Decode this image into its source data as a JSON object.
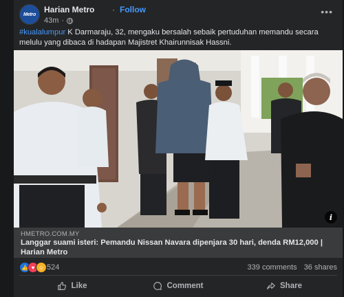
{
  "post": {
    "page_name": "Harian Metro",
    "follow_label": "Follow",
    "avatar_text": "Metro",
    "time": "43m",
    "caption_hashtag": "#kualalumpur",
    "caption_text": " K Darmaraju, 32, mengaku bersalah sebaik pertuduhan memandu secara melulu yang dibaca di hadapan Majistret Khairunnisak Hassni.",
    "more_icon": "more-options-icon",
    "info_label": "i"
  },
  "link": {
    "domain": "HMETRO.COM.MY",
    "title": "Langgar suami isteri: Pemandu Nissan Navara dipenjara 30 hari, denda RM12,000 | Harian Metro"
  },
  "stats": {
    "reactions_count": "524",
    "comments": "339 comments",
    "shares": "36 shares"
  },
  "actions": {
    "like": "Like",
    "comment": "Comment",
    "share": "Share"
  },
  "colors": {
    "background": "#18191a",
    "card": "#242526",
    "link_accent": "#4599ff"
  }
}
